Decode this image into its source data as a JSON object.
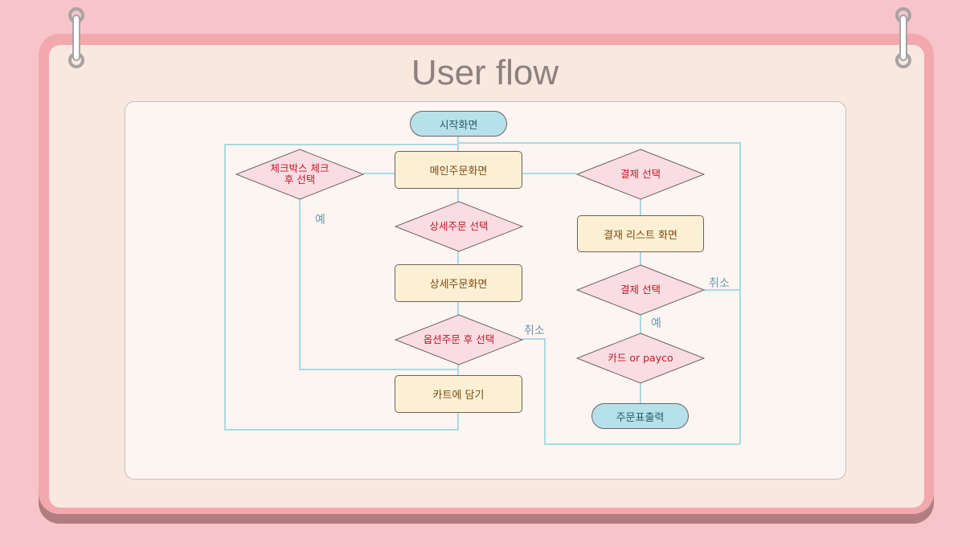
{
  "title": "User flow",
  "colors": {
    "background": "#f7c5c9",
    "frame": "#f2a9ae",
    "board": "#f8e8df",
    "canvas": "#fdf5f2",
    "connector": "#a6dbe0",
    "process_fill": "#fbf0d3",
    "decision_fill": "#f9dde2",
    "terminal_fill": "#b6e0ea",
    "decision_text": "#c0182a"
  },
  "nodes": {
    "start": "시작화면",
    "main_order": "메인주문화면",
    "checkbox_select": "체크박스 체크\n후 선택",
    "detail_select": "상세주문 선택",
    "detail_screen": "상세주문화면",
    "option_select": "옵션주문 후 선택",
    "add_cart": "카트에 담기",
    "payment_select_1": "결제 선택",
    "payment_list": "결재 리스트 화면",
    "payment_select_2": "결제 선택",
    "card_payco": "카드 or payco",
    "print_receipt": "주문표출력"
  },
  "edge_labels": {
    "checkbox_yes": "예",
    "option_cancel": "취소",
    "payment_cancel": "취소",
    "payment_yes": "예"
  }
}
